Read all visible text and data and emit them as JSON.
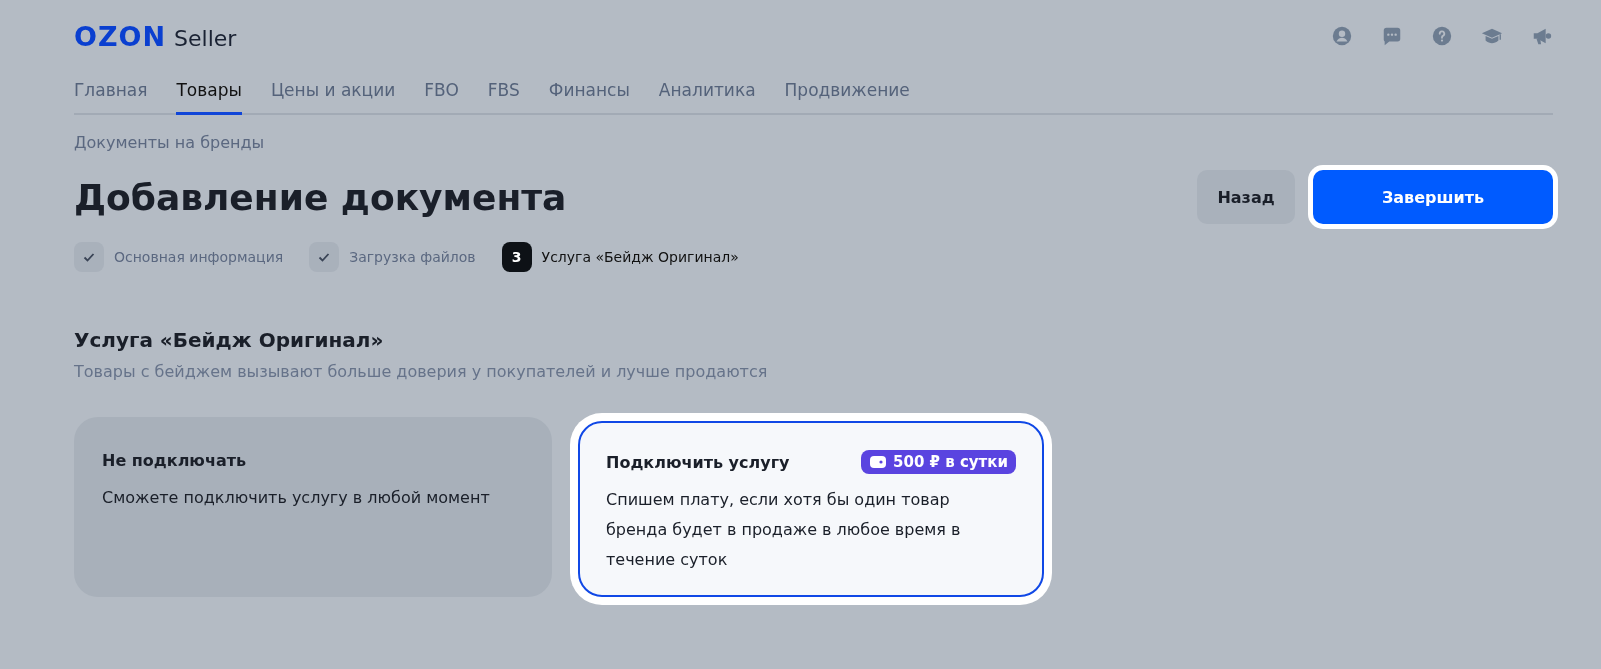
{
  "header": {
    "logo": "OZON",
    "product": "Seller"
  },
  "nav": [
    {
      "label": "Главная",
      "selected": false
    },
    {
      "label": "Товары",
      "selected": true
    },
    {
      "label": "Цены и акции",
      "selected": false
    },
    {
      "label": "FBO",
      "selected": false
    },
    {
      "label": "FBS",
      "selected": false
    },
    {
      "label": "Финансы",
      "selected": false
    },
    {
      "label": "Аналитика",
      "selected": false
    },
    {
      "label": "Продвижение",
      "selected": false
    }
  ],
  "breadcrumb": "Документы на бренды",
  "title": "Добавление документа",
  "buttons": [
    {
      "label": "Назад",
      "kind": "secondary"
    },
    {
      "label": "Завершить",
      "kind": "primary"
    }
  ],
  "steps": [
    {
      "label": "Основная информация",
      "done": true
    },
    {
      "label": "Загрузка файлов",
      "done": true
    },
    {
      "label": "Услуга «Бейдж Оригинал»",
      "done": false,
      "number": "3"
    }
  ],
  "section": {
    "title": "Услуга «Бейдж Оригинал»",
    "subtitle": "Товары с бейджем вызывают больше доверия у покупателей и лучше продаются"
  },
  "options": [
    {
      "title": "Не подключать",
      "description": "Сможете подключить услугу в любой момент",
      "selected": false
    },
    {
      "title": "Подключить услугу",
      "description": "Спишем плату, если хотя бы один товар бренда будет в продаже в любое время в течение суток",
      "selected": true,
      "badge": "500 ₽ в сутки"
    }
  ]
}
